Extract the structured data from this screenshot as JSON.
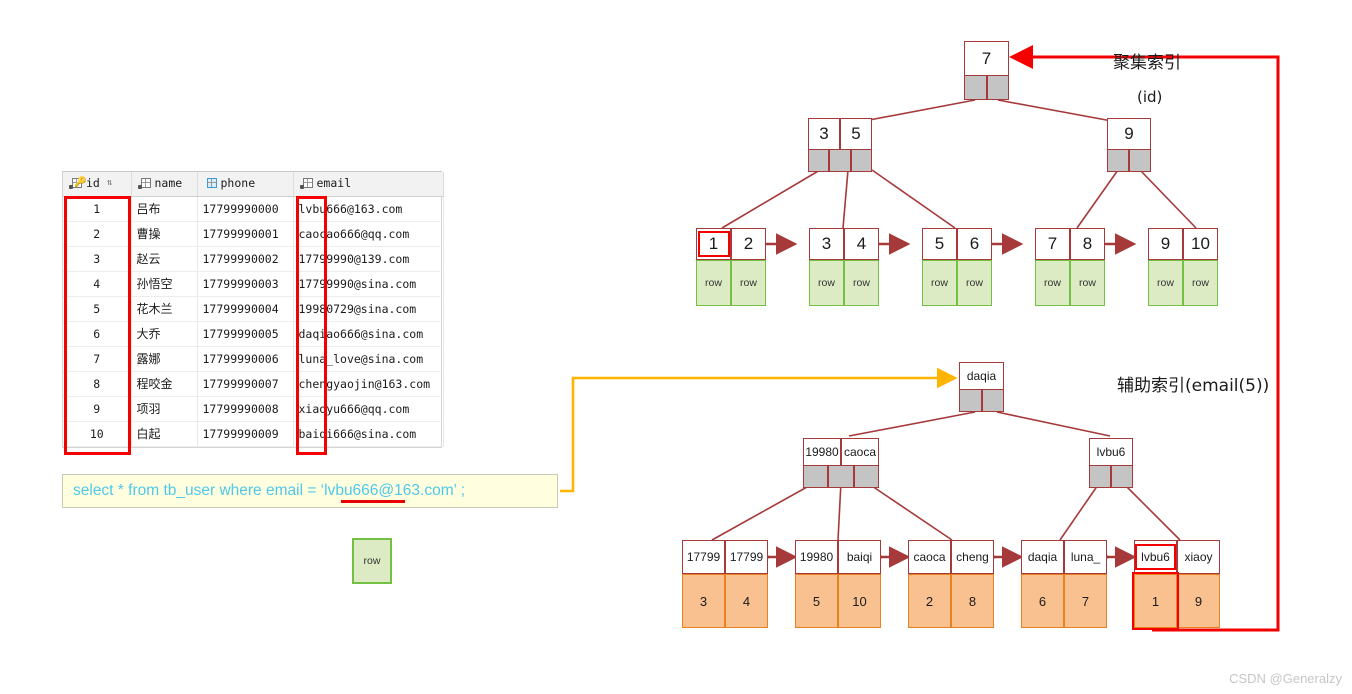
{
  "result_table": {
    "columns": [
      {
        "label": "id",
        "icon": "primary-key-icon"
      },
      {
        "label": "name",
        "icon": "column-icon"
      },
      {
        "label": "phone",
        "icon": "column-icon-blue"
      },
      {
        "label": "email",
        "icon": "column-icon"
      }
    ],
    "sort_indicator": "⇅",
    "rows": [
      {
        "id": "1",
        "name": "吕布",
        "phone": "17799990000",
        "email": "lvbu666@163.com"
      },
      {
        "id": "2",
        "name": "曹操",
        "phone": "17799990001",
        "email": "caocao666@qq.com"
      },
      {
        "id": "3",
        "name": "赵云",
        "phone": "17799990002",
        "email": "17799990@139.com"
      },
      {
        "id": "4",
        "name": "孙悟空",
        "phone": "17799990003",
        "email": "17799990@sina.com"
      },
      {
        "id": "5",
        "name": "花木兰",
        "phone": "17799990004",
        "email": "19980729@sina.com"
      },
      {
        "id": "6",
        "name": "大乔",
        "phone": "17799990005",
        "email": "daqiao666@sina.com"
      },
      {
        "id": "7",
        "name": "露娜",
        "phone": "17799990006",
        "email": "luna_love@sina.com"
      },
      {
        "id": "8",
        "name": "程咬金",
        "phone": "17799990007",
        "email": "chengyaojin@163.com"
      },
      {
        "id": "9",
        "name": "项羽",
        "phone": "17799990008",
        "email": "xiaoyu666@qq.com"
      },
      {
        "id": "10",
        "name": "白起",
        "phone": "17799990009",
        "email": "baiqi666@sina.com"
      }
    ]
  },
  "sql": {
    "prefix": "select * from tb_user where email = ‘",
    "literal": "lvbu666@163.com",
    "suffix": "’ ;"
  },
  "labels": {
    "clustered_index": "聚集索引",
    "clustered_index_sub": "(id)",
    "secondary_index": "辅助索引(email(5))",
    "row_box": "row"
  },
  "clustered_index": {
    "root": {
      "keys": [
        "7"
      ],
      "ptrs": 2
    },
    "level2": [
      {
        "keys": [
          "3",
          "5"
        ],
        "ptrs": 3
      },
      {
        "keys": [
          "9"
        ],
        "ptrs": 2
      }
    ],
    "leaves": [
      {
        "keys": [
          "1",
          "2"
        ],
        "rows": [
          "row",
          "row"
        ],
        "highlight": 0
      },
      {
        "keys": [
          "3",
          "4"
        ],
        "rows": [
          "row",
          "row"
        ]
      },
      {
        "keys": [
          "5",
          "6"
        ],
        "rows": [
          "row",
          "row"
        ]
      },
      {
        "keys": [
          "7",
          "8"
        ],
        "rows": [
          "row",
          "row"
        ]
      },
      {
        "keys": [
          "9",
          "10"
        ],
        "rows": [
          "row",
          "row"
        ]
      }
    ]
  },
  "secondary_index": {
    "root": {
      "keys": [
        "daqia"
      ],
      "ptrs": 2
    },
    "level2": [
      {
        "keys": [
          "19980",
          "caoca"
        ],
        "ptrs": 3
      },
      {
        "keys": [
          "lvbu6"
        ],
        "ptrs": 2
      }
    ],
    "leaves": [
      {
        "keys": [
          "17799",
          "17799"
        ],
        "ids": [
          "3",
          "4"
        ]
      },
      {
        "keys": [
          "19980",
          "baiqi"
        ],
        "ids": [
          "5",
          "10"
        ]
      },
      {
        "keys": [
          "caoca",
          "cheng"
        ],
        "ids": [
          "2",
          "8"
        ]
      },
      {
        "keys": [
          "daqia",
          "luna_"
        ],
        "ids": [
          "6",
          "7"
        ]
      },
      {
        "keys": [
          "lvbu6",
          "xiaoy"
        ],
        "ids": [
          "1",
          "9"
        ],
        "highlight": 0
      }
    ]
  },
  "colors": {
    "node_border": "#a63a3a",
    "pointer_fill": "#c4c4c4",
    "row_fill": "#dcebc4",
    "row_border": "#74c043",
    "id_fill": "#f9c190",
    "id_border": "#e8821e",
    "highlight_red": "#f40000",
    "lookup_arrow": "#ffb400",
    "sql_text": "#4ec8ea",
    "sql_background": "#ffffdf"
  },
  "watermark": "CSDN @Generalzy"
}
